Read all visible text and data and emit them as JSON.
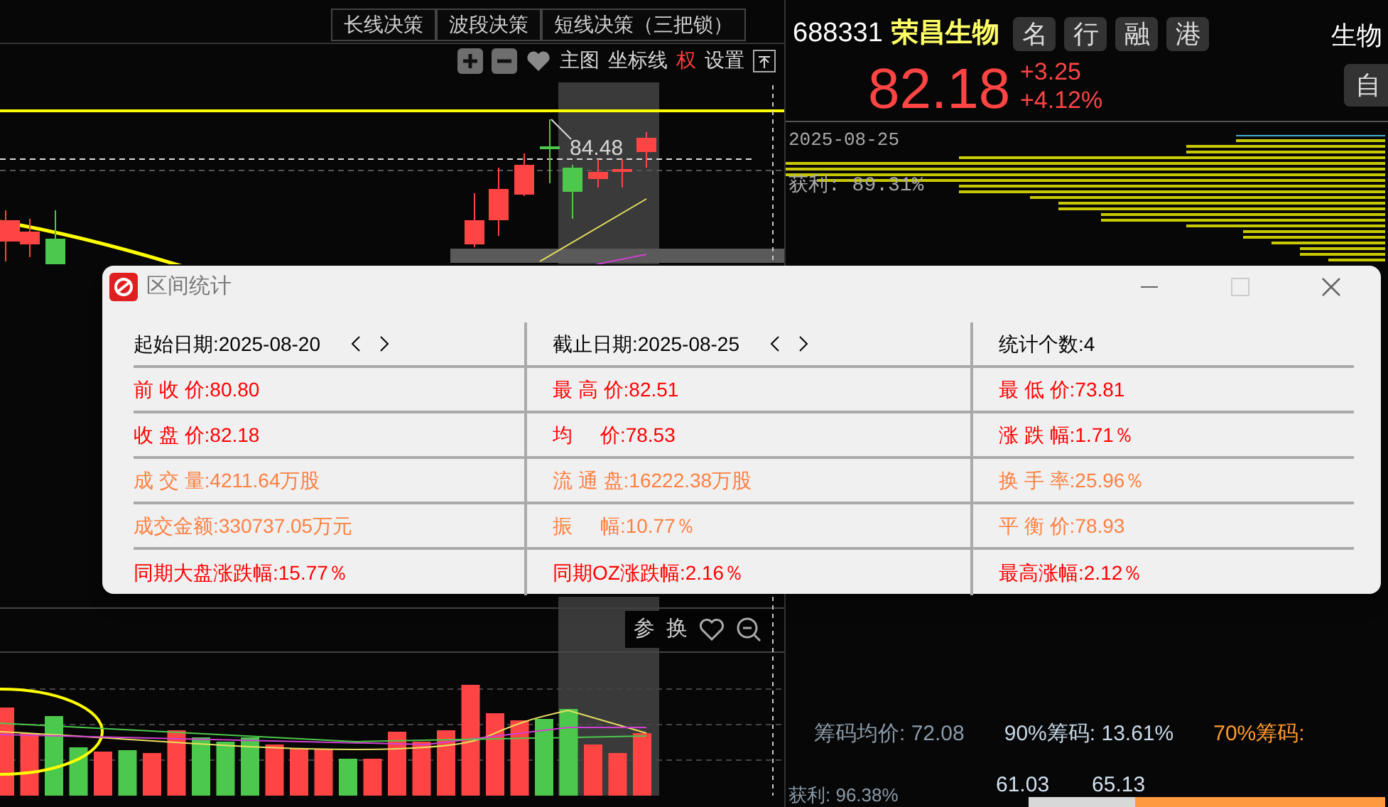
{
  "strategy_tabs": [
    {
      "label": "长线决策",
      "selected": false
    },
    {
      "label": "波段决策",
      "selected": false
    },
    {
      "label": "短线决策（三把锁）",
      "selected": false
    }
  ],
  "chart_toolbar": [
    {
      "kind": "plus"
    },
    {
      "kind": "minus"
    },
    {
      "kind": "heart"
    },
    {
      "kind": "text",
      "label": "主图"
    },
    {
      "kind": "text",
      "label": "坐标线"
    },
    {
      "kind": "accent",
      "label": "权"
    },
    {
      "kind": "text",
      "label": "设置"
    },
    {
      "kind": "pin"
    }
  ],
  "price_marker": "84.48",
  "volume_toolbar": [
    {
      "kind": "text",
      "label": "参"
    },
    {
      "kind": "text",
      "label": "换"
    },
    {
      "kind": "heart"
    },
    {
      "kind": "zoom_out"
    }
  ],
  "quote": {
    "code": "688331",
    "name": "荣昌生物",
    "tags": [
      "名",
      "行",
      "融",
      "港"
    ],
    "sector": "生物",
    "price": "82.18",
    "change": "+3.25",
    "change_pct": "+4.12%",
    "side_button": "自"
  },
  "chip_overlay": {
    "date": "2025-08-25",
    "profit": "获利: 89.31%"
  },
  "chip_stats": [
    {
      "text": "筹码均价: 72.08",
      "kind": "gray"
    },
    {
      "text": "90%筹码: 13.61%",
      "kind": "light"
    },
    {
      "text": "70%筹码:",
      "kind": "orange"
    }
  ],
  "chip_range": [
    "61.03",
    "65.13"
  ],
  "chip_profit": "获利: 96.38%",
  "dialog": {
    "title": "区间统计",
    "rows": [
      [
        {
          "text": "起始日期:2025-08-20",
          "kind": "date"
        },
        {
          "text": "截止日期:2025-08-25",
          "kind": "date"
        },
        {
          "text": "统计个数:4",
          "kind": "plain"
        }
      ],
      [
        {
          "text": "前 收 价:80.80",
          "kind": "red"
        },
        {
          "text": "最 高 价:82.51",
          "kind": "red"
        },
        {
          "text": "最 低 价:73.81",
          "kind": "red"
        }
      ],
      [
        {
          "text": "收 盘 价:82.18",
          "kind": "red"
        },
        {
          "text": "均     价:78.53",
          "kind": "red"
        },
        {
          "text": "涨 跌 幅:1.71％",
          "kind": "red"
        }
      ],
      [
        {
          "text": "成 交 量:4211.64万股",
          "kind": "orange"
        },
        {
          "text": "流 通 盘:16222.38万股",
          "kind": "orange"
        },
        {
          "text": "换 手 率:25.96％",
          "kind": "orange"
        }
      ],
      [
        {
          "text": "成交金额:330737.05万元",
          "kind": "orange"
        },
        {
          "text": "振     幅:10.77％",
          "kind": "orange"
        },
        {
          "text": "平 衡 价:78.93",
          "kind": "orange"
        }
      ],
      [
        {
          "text": "同期大盘涨跌幅:15.77％",
          "kind": "red"
        },
        {
          "text": "同期OZ涨跌幅:2.16％",
          "kind": "red"
        },
        {
          "text": "最高涨幅:2.12％",
          "kind": "red"
        }
      ]
    ]
  }
}
